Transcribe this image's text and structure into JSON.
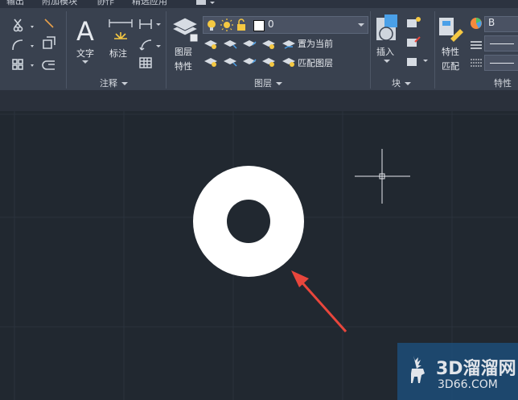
{
  "tabs": [
    "输出",
    "附加模块",
    "协作",
    "精选应用"
  ],
  "panels": {
    "annotation": {
      "title": "注释",
      "text_tool": "文字",
      "dim_tool": "标注"
    },
    "layers": {
      "title": "图层",
      "layer_props_line1": "图层",
      "layer_props_line2": "特性",
      "current_layer": "0",
      "set_current": "置为当前",
      "match_layer": "匹配图层"
    },
    "block": {
      "title": "块",
      "insert": "插入"
    },
    "properties": {
      "title": "特性",
      "match_line1": "特性",
      "match_line2": "匹配",
      "color_value": "B"
    }
  },
  "watermark": {
    "name": "3D溜溜网",
    "url": "3D66.COM"
  },
  "colors": {
    "ribbon": "#39414f",
    "canvas": "#212830",
    "annotation_arrow": "#e8463c",
    "donut": "#ffffff"
  }
}
